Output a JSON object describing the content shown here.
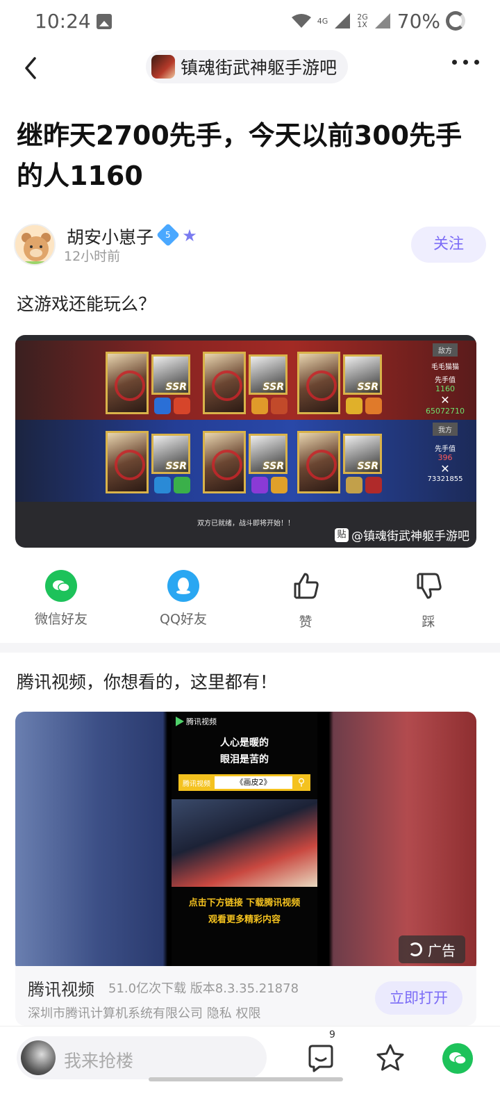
{
  "status_bar": {
    "time": "10:24",
    "network_1": "4G",
    "network_2": "2G",
    "network_3": "1X",
    "battery": "70%"
  },
  "nav": {
    "forum_name": "镇魂街武神躯手游吧"
  },
  "post": {
    "title": "继昨天2700先手，今天以前300先手的人1160",
    "author": {
      "name": "胡安小崽子",
      "level": "5",
      "time": "12小时前"
    },
    "follow_label": "关注",
    "body": "这游戏还能玩么？",
    "image": {
      "enemy_tag": "敌方",
      "enemy_name": "毛毛猫猫",
      "enemy_initiative_label": "先手值",
      "enemy_initiative": "1160",
      "enemy_power": "65072710",
      "ally_tag": "我方",
      "ally_initiative_label": "先手值",
      "ally_initiative": "396",
      "ally_power": "73321855",
      "card_label": "SSR",
      "battle_message": "双方已就绪，战斗即将开始！！",
      "watermark": "@镇魂街武神躯手游吧",
      "watermark_icon": "贴"
    }
  },
  "share": [
    {
      "label": "微信好友",
      "icon": "wechat-icon",
      "color": "#1DC25A"
    },
    {
      "label": "QQ好友",
      "icon": "qq-icon",
      "color": "#2AA7F2"
    },
    {
      "label": "赞",
      "icon": "thumbs-up-icon",
      "color": "#333333"
    },
    {
      "label": "踩",
      "icon": "thumbs-down-icon",
      "color": "#333333"
    }
  ],
  "ad": {
    "caption": "腾讯视频，你想看的，这里都有！",
    "logo_text": "腾讯视频",
    "line1": "人心是暖的",
    "line2": "眼泪是苦的",
    "search_label": "腾讯视频",
    "search_value": "《画皮2》",
    "cta1": "点击下方链接  下载腾讯视频",
    "cta2": "观看更多精彩内容",
    "badge": "广告",
    "app_name": "腾讯视频",
    "app_meta": "51.0亿次下载   版本8.3.35.21878",
    "app_company": "深圳市腾讯计算机系统有限公司   隐私   权限",
    "open_label": "立即打开"
  },
  "bottom": {
    "placeholder": "我来抢楼",
    "comment_count": "9"
  },
  "colors": {
    "accent": "#7B6CF6",
    "wechat": "#1DC25A",
    "qq": "#2AA7F2"
  }
}
